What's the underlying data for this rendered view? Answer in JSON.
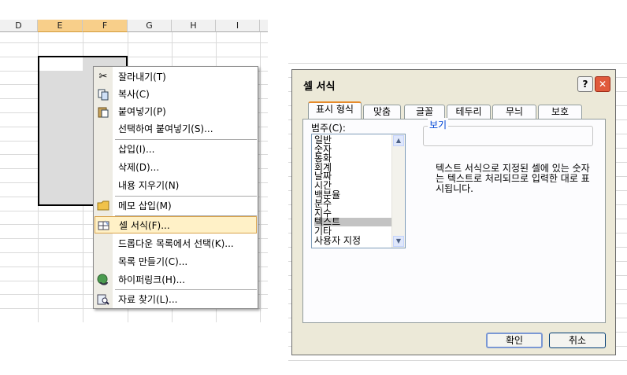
{
  "sheet": {
    "columns": [
      {
        "label": "D",
        "selected": false
      },
      {
        "label": "E",
        "selected": true
      },
      {
        "label": "F",
        "selected": true
      },
      {
        "label": "G",
        "selected": false
      },
      {
        "label": "H",
        "selected": false
      },
      {
        "label": "I",
        "selected": false
      }
    ]
  },
  "context_menu": {
    "items": [
      {
        "label": "잘라내기(T)",
        "icon": "scissors-icon"
      },
      {
        "label": "복사(C)",
        "icon": "copy-icon"
      },
      {
        "label": "붙여넣기(P)",
        "icon": "paste-icon"
      },
      {
        "label": "선택하여 붙여넣기(S)...",
        "icon": ""
      },
      {
        "label": "삽입(I)...",
        "icon": ""
      },
      {
        "label": "삭제(D)...",
        "icon": ""
      },
      {
        "label": "내용 지우기(N)",
        "icon": ""
      },
      {
        "label": "메모 삽입(M)",
        "icon": "comment-icon"
      },
      {
        "label": "셀 서식(F)...",
        "icon": "format-cells-icon"
      },
      {
        "label": "드롭다운 목록에서 선택(K)...",
        "icon": ""
      },
      {
        "label": "목록 만들기(C)...",
        "icon": ""
      },
      {
        "label": "하이퍼링크(H)...",
        "icon": "hyperlink-icon"
      },
      {
        "label": "자료 찾기(L)...",
        "icon": "research-icon"
      }
    ],
    "highlighted": "셀 서식(F)..."
  },
  "dialog": {
    "title": "셀 서식",
    "help_label": "?",
    "close_label": "✕",
    "tabs": [
      "표시 형식",
      "맞춤",
      "글꼴",
      "테두리",
      "무늬",
      "보호"
    ],
    "active_tab": "표시 형식",
    "category_label": "범주(C):",
    "categories": [
      "일반",
      "숫자",
      "통화",
      "회계",
      "날짜",
      "시간",
      "백분율",
      "분수",
      "지수",
      "텍스트",
      "기타",
      "사용자 지정"
    ],
    "selected_category": "텍스트",
    "preview_label": "보기",
    "description": "텍스트 서식으로 지정된 셀에 있는 숫자는 텍스트로 처리되므로 입력한 대로 표시됩니다.",
    "ok_label": "확인",
    "cancel_label": "취소"
  },
  "colors": {
    "selected_header": "#f8cf8a",
    "menu_highlight": "#fff1c7",
    "dialog_face": "#ece9d8",
    "tab_accent": "#e68b2c",
    "close_button": "#e05a3c"
  }
}
